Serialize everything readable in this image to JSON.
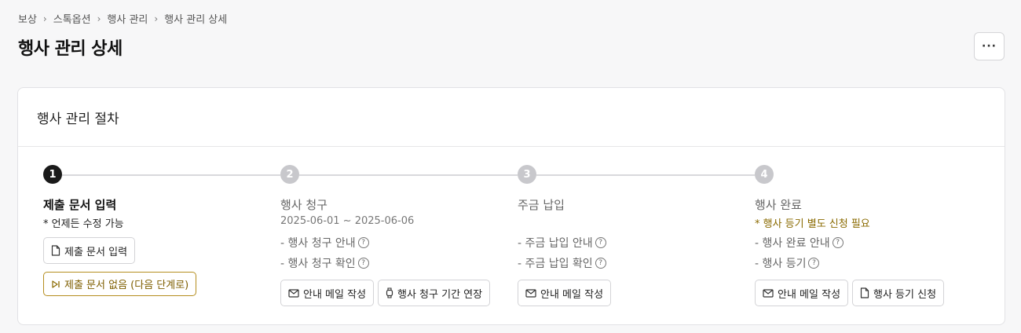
{
  "breadcrumb": [
    "보상",
    "스톡옵션",
    "행사 관리",
    "행사 관리 상세"
  ],
  "page_title": "행사 관리 상세",
  "more_button": "···",
  "card_title": "행사 관리 절차",
  "steps": [
    {
      "num": "1",
      "title": "제출 문서 입력",
      "sub": "* 언제든 수정 가능",
      "buttons": [
        "제출 문서 입력",
        "제출 문서 없음 (다음 단계로)"
      ]
    },
    {
      "num": "2",
      "title": "행사 청구",
      "sub": "2025-06-01 ~ 2025-06-06",
      "tasks": [
        "- 행사 청구 안내",
        "- 행사 청구 확인"
      ],
      "buttons": [
        "안내 메일 작성",
        "행사 청구 기간 연장"
      ]
    },
    {
      "num": "3",
      "title": "주금 납입",
      "tasks": [
        "- 주금 납입 안내",
        "- 주금 납입 확인"
      ],
      "buttons": [
        "안내 메일 작성"
      ]
    },
    {
      "num": "4",
      "title": "행사 완료",
      "sub": "* 행사 등기 별도 신청 필요",
      "tasks": [
        "- 행사 완료 안내",
        "- 행사 등기"
      ],
      "buttons": [
        "안내 메일 작성",
        "행사 등기 신청"
      ]
    }
  ],
  "help_glyph": "?",
  "colors": {
    "active": "#1a1a1a",
    "inactive": "#c8c8cc",
    "gold": "#8a6a00"
  }
}
